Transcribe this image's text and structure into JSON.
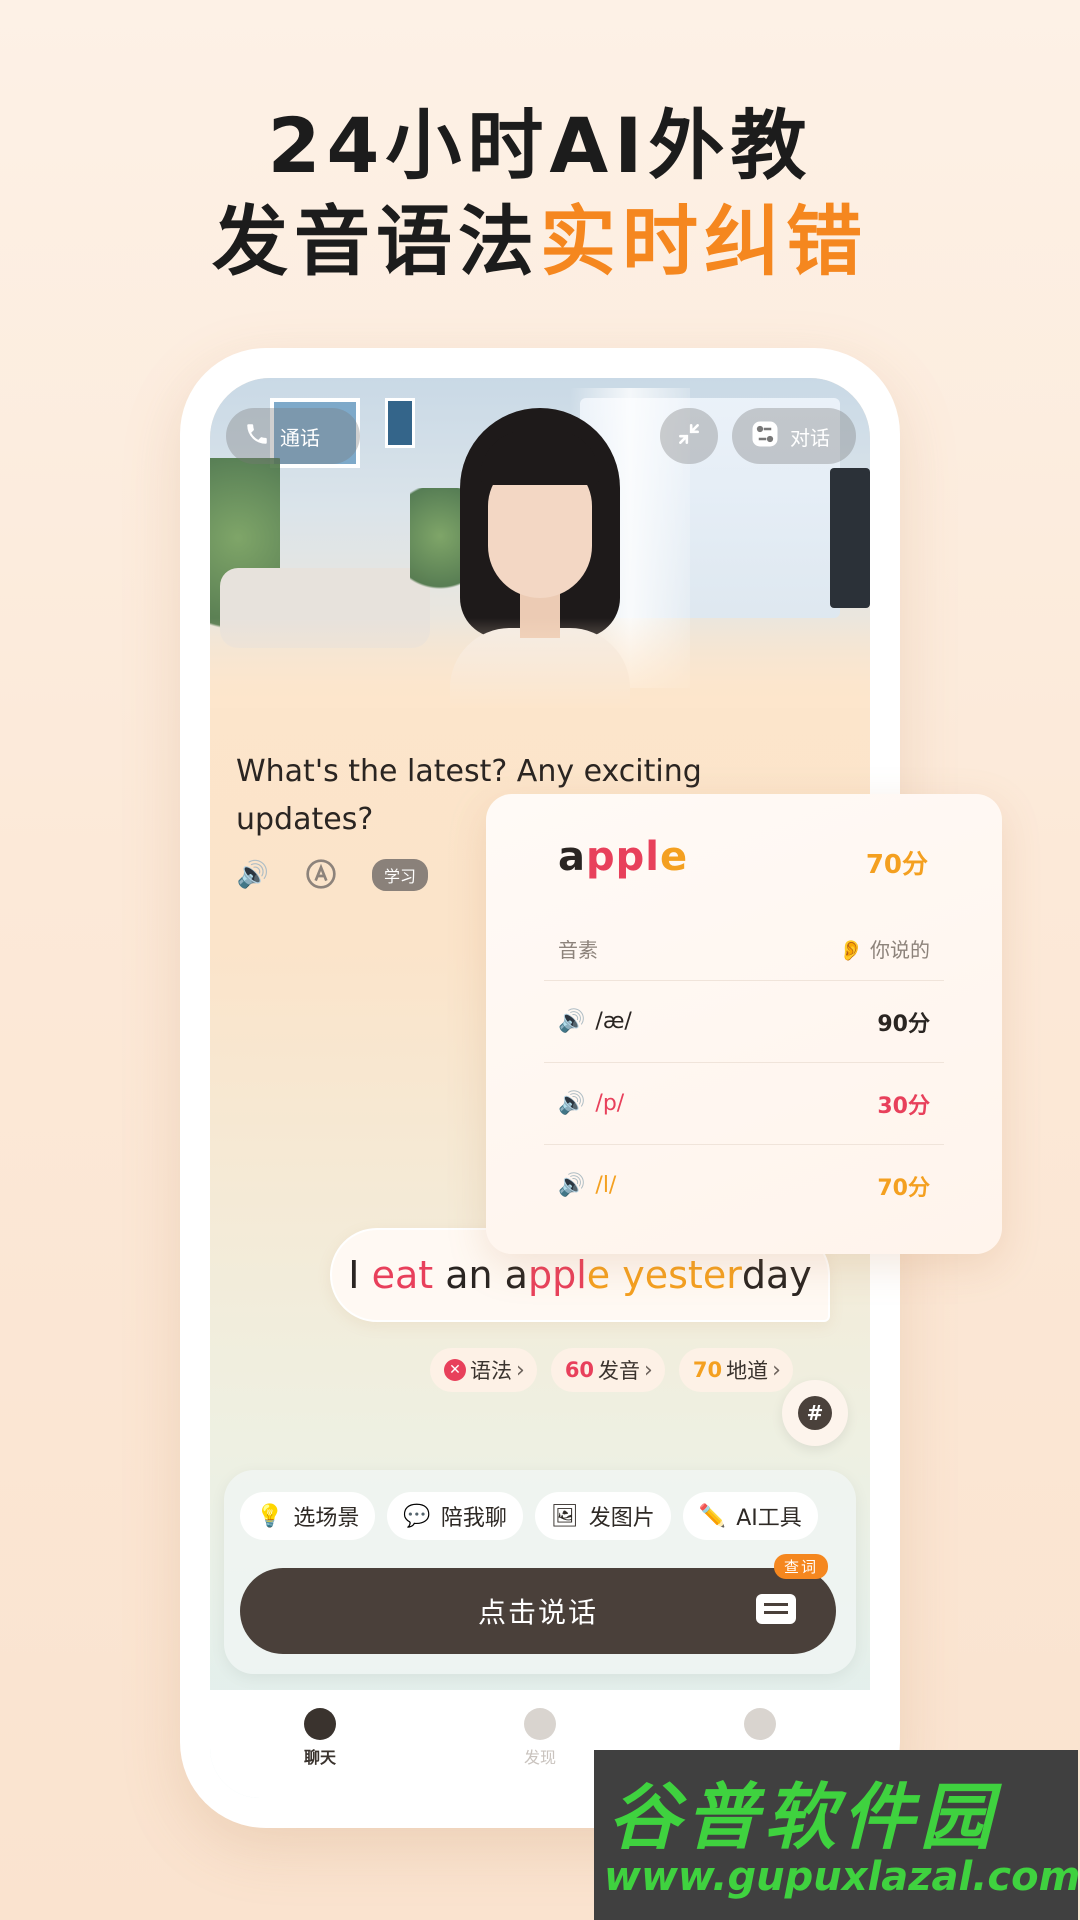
{
  "headline": {
    "line1": "24小时AI外教",
    "line2_plain": "发音语法",
    "line2_highlight": "实时纠错"
  },
  "top_buttons": {
    "call_label": "通话",
    "dialog_label": "对话"
  },
  "ai_message": {
    "text": "What's the latest? Any exciting updates?",
    "learn_badge": "学习"
  },
  "user_message": {
    "parts": [
      "I ",
      "eat",
      " an a",
      "ppl",
      "e ",
      "yester",
      "day"
    ]
  },
  "feedback_chips": {
    "grammar_label": "语法",
    "pronunciation_score": "60",
    "pronunciation_label": "发音",
    "fluency_score": "70",
    "fluency_label": "地道"
  },
  "quick_actions": [
    {
      "label": "选场景",
      "icon": "lightbulb-icon"
    },
    {
      "label": "陪我聊",
      "icon": "chat-icon"
    },
    {
      "label": "发图片",
      "icon": "image-icon"
    },
    {
      "label": "AI工具",
      "icon": "pencil-icon"
    }
  ],
  "talk_button": {
    "label": "点击说话",
    "dict_tag": "查词"
  },
  "tabbar": [
    {
      "label": "聊天",
      "active": true
    },
    {
      "label": "发现",
      "active": false
    },
    {
      "label": "",
      "active": false
    }
  ],
  "score_card": {
    "word_parts": [
      "a",
      "ppl",
      "e"
    ],
    "score": "70分",
    "header_left": "音素",
    "header_right": "你说的",
    "rows": [
      {
        "phoneme": "/æ/",
        "score": "90分",
        "color": "#2a2522"
      },
      {
        "phoneme": "/p/",
        "score": "30分",
        "color": "#e8405b"
      },
      {
        "phoneme": "/l/",
        "score": "70分",
        "color": "#f4a020"
      }
    ]
  },
  "watermark": {
    "line1": "谷普软件园",
    "line2": "www.gupuxlazal.com"
  },
  "colors": {
    "accent": "#f5871f",
    "error": "#e8405b",
    "warning": "#f4a020",
    "button_dark": "#4a403a"
  }
}
